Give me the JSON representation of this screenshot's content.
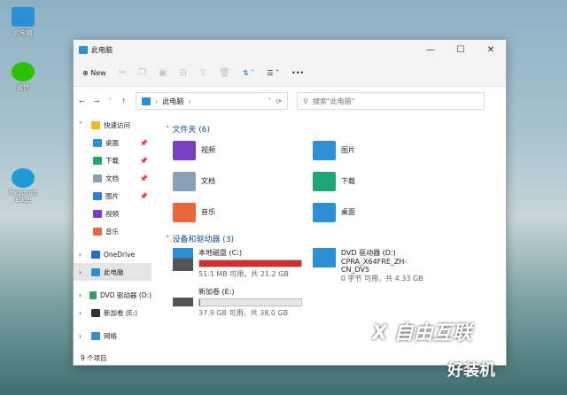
{
  "desktop": {
    "icons": [
      {
        "label": "此电脑"
      },
      {
        "label": "微信"
      },
      {
        "label": "Microsoft Edge"
      }
    ]
  },
  "window": {
    "title": "此电脑",
    "minimize": "—",
    "maximize": "☐",
    "close": "✕"
  },
  "toolbar": {
    "new_label": "New",
    "sort": "⇅ ˅",
    "view": "☰ ˅",
    "more": "•••"
  },
  "address": {
    "path": "此电脑",
    "search_placeholder": "搜索\"此电脑\""
  },
  "sidebar": {
    "items": [
      {
        "label": "快速访问",
        "color": "#f2b90f",
        "chev": "˅"
      },
      {
        "label": "桌面",
        "color": "#2b8fd6",
        "pin": true
      },
      {
        "label": "下载",
        "color": "#1ea67a",
        "pin": true
      },
      {
        "label": "文档",
        "color": "#8aa0b8",
        "pin": true
      },
      {
        "label": "图片",
        "color": "#2f7bd6",
        "pin": true
      },
      {
        "label": "视频",
        "color": "#7b3fc4"
      },
      {
        "label": "音乐",
        "color": "#e8663a"
      },
      {
        "label": "OneDrive",
        "color": "#1f6fc6",
        "chev": "›"
      },
      {
        "label": "此电脑",
        "color": "#2b8fd6",
        "chev": "›",
        "selected": true
      },
      {
        "label": "DVD 驱动器 (D:)",
        "color": "#3a9a6a",
        "chev": "›"
      },
      {
        "label": "新加卷 (E:)",
        "color": "#333",
        "chev": "›"
      },
      {
        "label": "网络",
        "color": "#3a8ad6",
        "chev": "›"
      }
    ]
  },
  "folders": {
    "heading": "文件夹 (6)",
    "items": [
      {
        "label": "视频",
        "color": "#7b3fc4"
      },
      {
        "label": "图片",
        "color": "#2f8fd6"
      },
      {
        "label": "文档",
        "color": "#8aa0b8"
      },
      {
        "label": "下载",
        "color": "#1ea67a"
      },
      {
        "label": "音乐",
        "color": "#e8663a"
      },
      {
        "label": "桌面",
        "color": "#2b8fd6"
      }
    ]
  },
  "drives": {
    "heading": "设备和驱动器 (3)",
    "items": [
      {
        "name": "本地磁盘 (C:)",
        "info": "51.1 MB 可用，共 21.2 GB",
        "used_percent": 99.8,
        "bar_color": "#d32f2f"
      },
      {
        "name": "DVD 驱动器 (D:)",
        "subtitle": "CPRA_X64FRE_ZH-CN_DV5",
        "info": "0 字节 可用，共 4.33 GB"
      },
      {
        "name": "新加卷 (E:)",
        "info": "37.9 GB 可用，共 38.0 GB",
        "used_percent": 0.3,
        "bar_color": "#2b8fd6"
      }
    ]
  },
  "status": {
    "count": "9 个项目"
  },
  "watermark": {
    "brand1": "自由互联",
    "brand2": "好装机"
  }
}
